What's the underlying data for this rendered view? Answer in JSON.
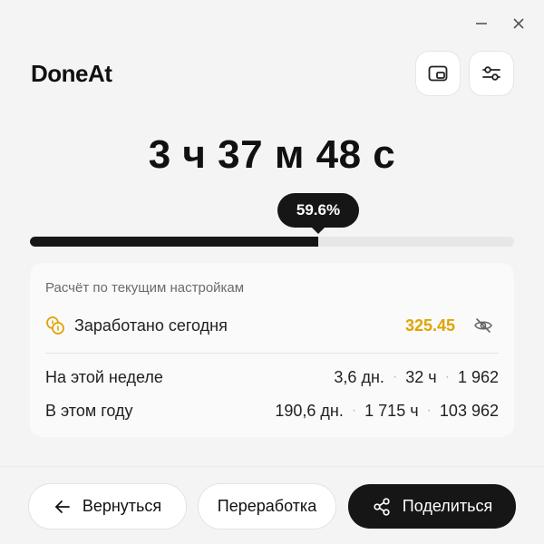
{
  "app": {
    "title": "DoneAt"
  },
  "window": {
    "minimize_icon": "minimize-icon",
    "close_icon": "close-icon"
  },
  "header": {
    "pip_icon": "picture-in-picture-icon",
    "settings_icon": "sliders-icon"
  },
  "timer": {
    "display": "3 ч 37 м 48 с"
  },
  "progress": {
    "label": "59.6%",
    "fraction": 0.596
  },
  "card": {
    "caption": "Расчёт по текущим настройкам",
    "earned": {
      "label": "Заработано сегодня",
      "value": "325.45",
      "icon": "coins-icon",
      "hide_icon": "eye-off-icon",
      "value_color": "#e0a400"
    },
    "week": {
      "label": "На этой неделе",
      "days": "3,6 дн.",
      "hours": "32 ч",
      "amount": "1 962"
    },
    "year": {
      "label": "В этом году",
      "days": "190,6 дн.",
      "hours": "1 715 ч",
      "amount": "103 962"
    }
  },
  "footer": {
    "back_label": "Вернуться",
    "overtime_label": "Переработка",
    "share_label": "Поделиться"
  },
  "colors": {
    "accent_dark": "#161616",
    "earned_gold": "#e0a400",
    "background": "#f4f4f5"
  }
}
